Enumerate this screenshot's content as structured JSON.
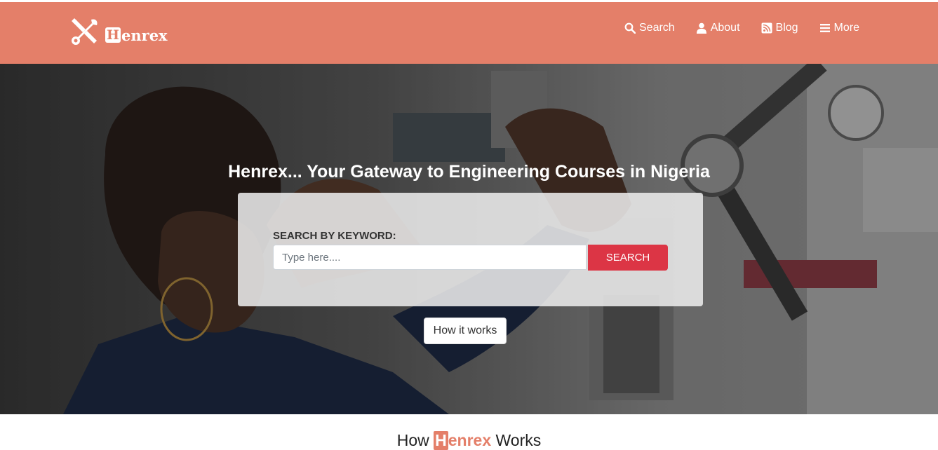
{
  "brand": {
    "logo_icon": "tools-icon",
    "initial": "H",
    "rest": "enrex"
  },
  "nav": {
    "items": [
      {
        "label": "Search",
        "icon": "search-icon"
      },
      {
        "label": "About",
        "icon": "user-icon"
      },
      {
        "label": "Blog",
        "icon": "rss-icon"
      },
      {
        "label": "More",
        "icon": "menu-icon"
      }
    ]
  },
  "hero": {
    "title": "Henrex... Your Gateway to Engineering Courses in Nigeria",
    "search_label": "SEARCH BY KEYWORD:",
    "search_placeholder": "Type here....",
    "search_button": "SEARCH",
    "how_button": "How it works"
  },
  "section": {
    "title_prefix": "How ",
    "title_brand_initial": "H",
    "title_brand_rest": "enrex",
    "title_suffix": " Works"
  },
  "colors": {
    "brand": "#e47f69",
    "search_button": "#dc3545",
    "white": "#ffffff"
  }
}
